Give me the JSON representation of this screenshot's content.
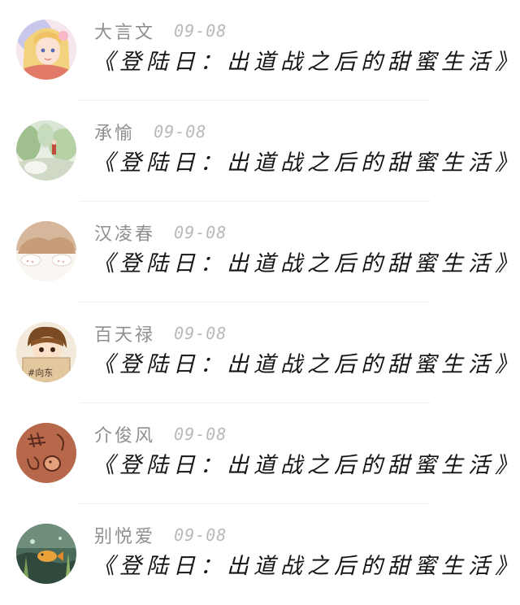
{
  "comments": [
    {
      "name": "大言文",
      "date": "09-08",
      "text": "《登陆日：出道战之后的甜蜜生活》",
      "avatar": "anime-girl-avatar"
    },
    {
      "name": "承愉",
      "date": "09-08",
      "text": "《登陆日：出道战之后的甜蜜生活》",
      "avatar": "forest-painting-avatar"
    },
    {
      "name": "汉凌春",
      "date": "09-08",
      "text": "《登陆日：出道战之后的甜蜜生活》",
      "avatar": "cat-paws-avatar"
    },
    {
      "name": "百天禄",
      "date": "09-08",
      "text": "《登陆日：出道战之后的甜蜜生活》",
      "avatar": "cartoon-boy-avatar"
    },
    {
      "name": "介俊风",
      "date": "09-08",
      "text": "《登陆日：出道战之后的甜蜜生活》",
      "avatar": "doodle-avatar"
    },
    {
      "name": "别悦爱",
      "date": "09-08",
      "text": "《登陆日：出道战之后的甜蜜生活》",
      "avatar": "aquarium-avatar"
    }
  ]
}
